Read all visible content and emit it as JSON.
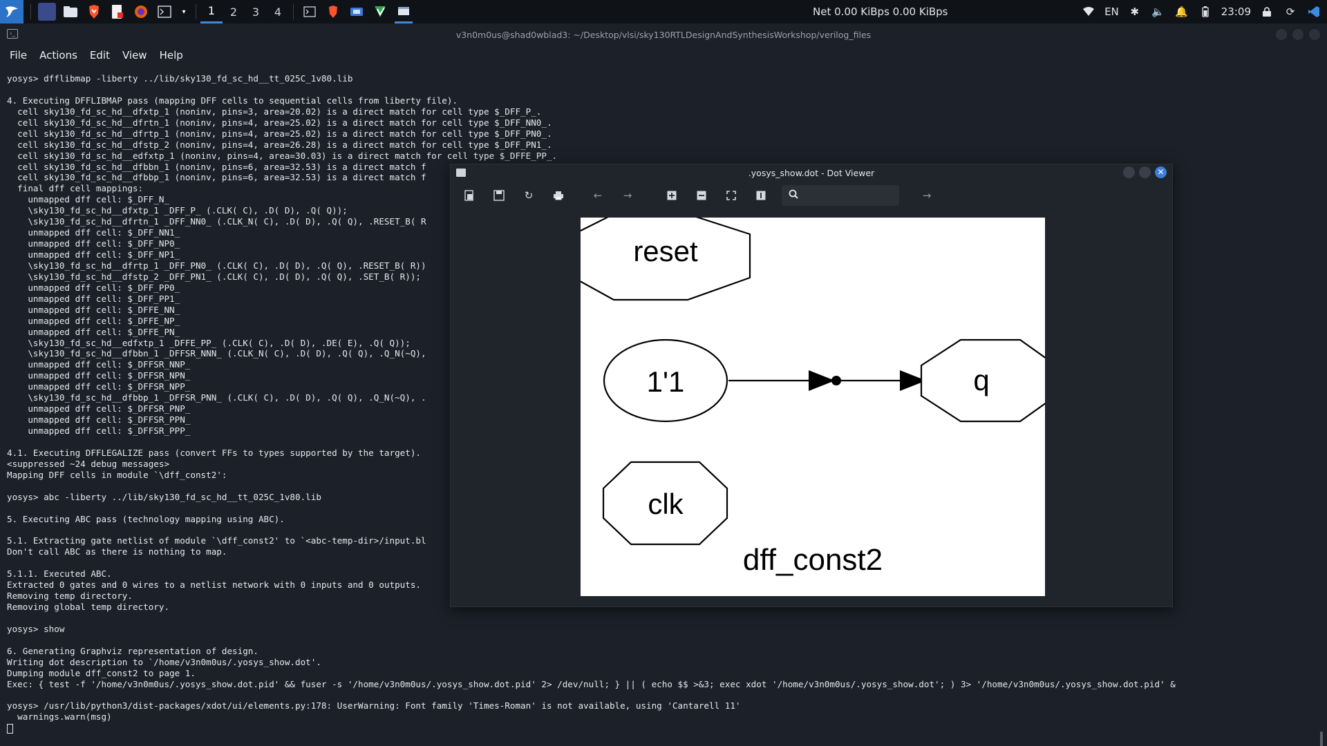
{
  "panel": {
    "workspaces": [
      "1",
      "2",
      "3",
      "4"
    ],
    "active_workspace": "1",
    "net": "Net 0.00 KiBps 0.00 KiBps",
    "lang": "EN",
    "clock": "23:09"
  },
  "terminal": {
    "title": "v3n0m0us@shad0wblad3: ~/Desktop/vlsi/sky130RTLDesignAndSynthesisWorkshop/verilog_files",
    "menu": [
      "File",
      "Actions",
      "Edit",
      "View",
      "Help"
    ],
    "lines": [
      "yosys> dfflibmap -liberty ../lib/sky130_fd_sc_hd__tt_025C_1v80.lib",
      "",
      "4. Executing DFFLIBMAP pass (mapping DFF cells to sequential cells from liberty file).",
      "  cell sky130_fd_sc_hd__dfxtp_1 (noninv, pins=3, area=20.02) is a direct match for cell type $_DFF_P_.",
      "  cell sky130_fd_sc_hd__dfrtn_1 (noninv, pins=4, area=25.02) is a direct match for cell type $_DFF_NN0_.",
      "  cell sky130_fd_sc_hd__dfrtp_1 (noninv, pins=4, area=25.02) is a direct match for cell type $_DFF_PN0_.",
      "  cell sky130_fd_sc_hd__dfstp_2 (noninv, pins=4, area=26.28) is a direct match for cell type $_DFF_PN1_.",
      "  cell sky130_fd_sc_hd__edfxtp_1 (noninv, pins=4, area=30.03) is a direct match for cell type $_DFFE_PP_.",
      "  cell sky130_fd_sc_hd__dfbbn_1 (noninv, pins=6, area=32.53) is a direct match f",
      "  cell sky130_fd_sc_hd__dfbbp_1 (noninv, pins=6, area=32.53) is a direct match f",
      "  final dff cell mappings:",
      "    unmapped dff cell: $_DFF_N_",
      "    \\sky130_fd_sc_hd__dfxtp_1 _DFF_P_ (.CLK( C), .D( D), .Q( Q));",
      "    \\sky130_fd_sc_hd__dfrtn_1 _DFF_NN0_ (.CLK_N( C), .D( D), .Q( Q), .RESET_B( R",
      "    unmapped dff cell: $_DFF_NN1_",
      "    unmapped dff cell: $_DFF_NP0_",
      "    unmapped dff cell: $_DFF_NP1_",
      "    \\sky130_fd_sc_hd__dfrtp_1 _DFF_PN0_ (.CLK( C), .D( D), .Q( Q), .RESET_B( R))",
      "    \\sky130_fd_sc_hd__dfstp_2 _DFF_PN1_ (.CLK( C), .D( D), .Q( Q), .SET_B( R));",
      "    unmapped dff cell: $_DFF_PP0_",
      "    unmapped dff cell: $_DFF_PP1_",
      "    unmapped dff cell: $_DFFE_NN_",
      "    unmapped dff cell: $_DFFE_NP_",
      "    unmapped dff cell: $_DFFE_PN_",
      "    \\sky130_fd_sc_hd__edfxtp_1 _DFFE_PP_ (.CLK( C), .D( D), .DE( E), .Q( Q));",
      "    \\sky130_fd_sc_hd__dfbbn_1 _DFFSR_NNN_ (.CLK_N( C), .D( D), .Q( Q), .Q_N(~Q),",
      "    unmapped dff cell: $_DFFSR_NNP_",
      "    unmapped dff cell: $_DFFSR_NPN_",
      "    unmapped dff cell: $_DFFSR_NPP_",
      "    \\sky130_fd_sc_hd__dfbbp_1 _DFFSR_PNN_ (.CLK( C), .D( D), .Q( Q), .Q_N(~Q), .",
      "    unmapped dff cell: $_DFFSR_PNP_",
      "    unmapped dff cell: $_DFFSR_PPN_",
      "    unmapped dff cell: $_DFFSR_PPP_",
      "",
      "4.1. Executing DFFLEGALIZE pass (convert FFs to types supported by the target).",
      "<suppressed ~24 debug messages>",
      "Mapping DFF cells in module `\\dff_const2':",
      "",
      "yosys> abc -liberty ../lib/sky130_fd_sc_hd__tt_025C_1v80.lib",
      "",
      "5. Executing ABC pass (technology mapping using ABC).",
      "",
      "5.1. Extracting gate netlist of module `\\dff_const2' to `<abc-temp-dir>/input.bl",
      "Don't call ABC as there is nothing to map.",
      "",
      "5.1.1. Executed ABC.",
      "Extracted 0 gates and 0 wires to a netlist network with 0 inputs and 0 outputs.",
      "Removing temp directory.",
      "Removing global temp directory.",
      "",
      "yosys> show",
      "",
      "6. Generating Graphviz representation of design.",
      "Writing dot description to `/home/v3n0m0us/.yosys_show.dot'.",
      "Dumping module dff_const2 to page 1.",
      "Exec: { test -f '/home/v3n0m0us/.yosys_show.dot.pid' && fuser -s '/home/v3n0m0us/.yosys_show.dot.pid' 2> /dev/null; } || ( echo $$ >&3; exec xdot '/home/v3n0m0us/.yosys_show.dot'; ) 3> '/home/v3n0m0us/.yosys_show.dot.pid' &",
      "",
      "yosys> /usr/lib/python3/dist-packages/xdot/ui/elements.py:178: UserWarning: Font family 'Times-Roman' is not available, using 'Cantarell 11'",
      "  warnings.warn(msg)"
    ]
  },
  "viewer": {
    "title": ".yosys_show.dot - Dot Viewer",
    "search_placeholder": "",
    "graph": {
      "nodes": [
        "reset",
        "1'1",
        "q",
        "clk"
      ],
      "label": "dff_const2"
    }
  }
}
